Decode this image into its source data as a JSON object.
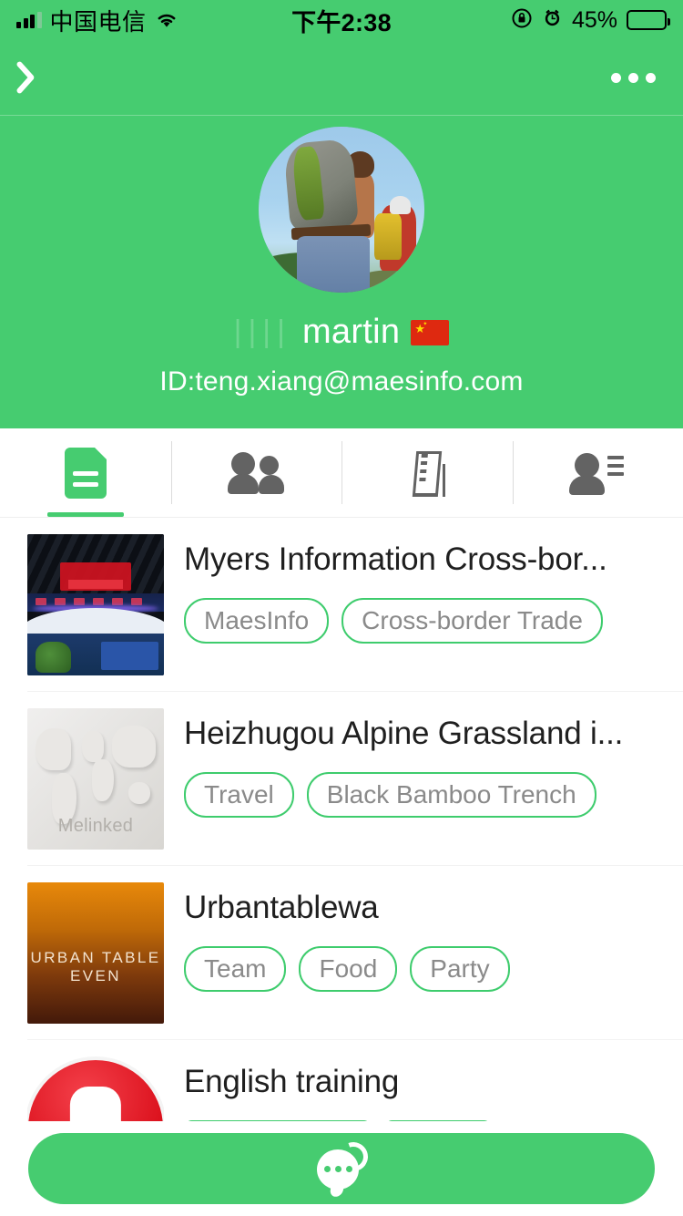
{
  "status_bar": {
    "carrier": "中国电信",
    "time": "下午2:38",
    "battery_percent": "45%",
    "battery_level": 45,
    "signal_icon": "signal-bars-icon",
    "wifi_icon": "wifi-icon",
    "rotation_lock_icon": "rotation-lock-icon",
    "alarm_icon": "alarm-clock-icon"
  },
  "navbar": {
    "back_icon": "back-chevron-icon",
    "more_icon": "more-options-icon"
  },
  "profile": {
    "avatar_alt": "hikers-with-backpacks-avatar",
    "name_prefix": "||||",
    "name": "martin",
    "flag": "china-flag-icon",
    "id": "ID:teng.xiang@maesinfo.com",
    "background_color": "#46CC70"
  },
  "tabs": [
    {
      "name": "documents",
      "icon": "document-icon",
      "active": true
    },
    {
      "name": "groups",
      "icon": "people-icon",
      "active": false
    },
    {
      "name": "companies",
      "icon": "building-icon",
      "active": false
    },
    {
      "name": "contacts",
      "icon": "person-list-icon",
      "active": false
    }
  ],
  "list": [
    {
      "title": "Myers Information Cross-bor...",
      "thumb": "expo-hall-photo",
      "tags": [
        "MaesInfo",
        "Cross-border Trade"
      ]
    },
    {
      "title": "Heizhugou Alpine Grassland i...",
      "thumb": "world-map-placeholder",
      "thumb_watermark": "Melinked",
      "tags": [
        "Travel",
        "Black Bamboo Trench"
      ]
    },
    {
      "title": "Urbantablewa",
      "thumb": "urban-table-gradient",
      "thumb_text": "URBAN TABLE EVEN",
      "tags": [
        "Team",
        "Food",
        "Party"
      ]
    },
    {
      "title": "English training",
      "thumb": "red-microphone-icon",
      "tags": [
        "",
        ""
      ]
    }
  ],
  "fab": {
    "name": "chat-button",
    "icon": "chat-bubble-icon",
    "color": "#46CC70"
  }
}
